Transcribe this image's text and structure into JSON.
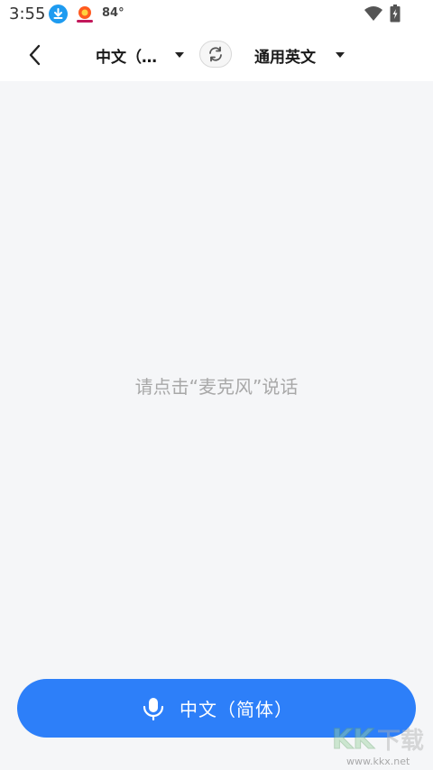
{
  "status_bar": {
    "time": "3:55",
    "temperature": "84°",
    "icons": [
      "download-icon",
      "app-notification-icon",
      "wifi-icon",
      "battery-charging-icon"
    ]
  },
  "top_bar": {
    "back_icon": "chevron-left-icon",
    "source_language": "中文（简体）",
    "target_language": "通用英文",
    "swap_icon": "swap-arrows-icon"
  },
  "main": {
    "prompt": "请点击“麦克风”说话"
  },
  "mic_button": {
    "icon": "microphone-icon",
    "label": "中文（简体）"
  },
  "watermark": {
    "logo_text": "KK下载",
    "url": "www.kkx.net"
  },
  "colors": {
    "accent": "#2d7ff9",
    "background": "#f5f6f8",
    "prompt_text": "#a8a8a8"
  }
}
